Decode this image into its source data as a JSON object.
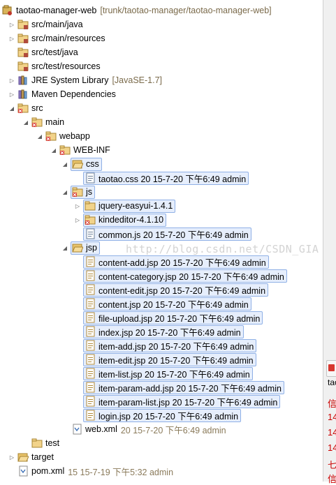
{
  "tree": {
    "project": {
      "name": "taotao-manager-web",
      "path": "[trunk/taotao-manager/taotao-manager-web]"
    },
    "src_main_java": "src/main/java",
    "src_main_resources": "src/main/resources",
    "src_test_java": "src/test/java",
    "src_test_resources": "src/test/resources",
    "jre": {
      "name": "JRE System Library",
      "decoration": "[JavaSE-1.7]"
    },
    "maven": "Maven Dependencies",
    "src": "src",
    "main": "main",
    "webapp": "webapp",
    "webinf": "WEB-INF",
    "css": "css",
    "taotao_css": "taotao.css 20  15-7-20 下午6:49  admin",
    "js": "js",
    "jquery": "jquery-easyui-1.4.1",
    "kindeditor": "kindeditor-4.1.10",
    "common_js": "common.js 20  15-7-20 下午6:49  admin",
    "jsp": "jsp",
    "jsp_files": [
      "content-add.jsp 20  15-7-20 下午6:49  admin",
      "content-category.jsp 20  15-7-20 下午6:49  admin",
      "content-edit.jsp 20  15-7-20 下午6:49  admin",
      "content.jsp 20  15-7-20 下午6:49  admin",
      "file-upload.jsp 20  15-7-20 下午6:49  admin",
      "index.jsp 20  15-7-20 下午6:49  admin",
      "item-add.jsp 20  15-7-20 下午6:49  admin",
      "item-edit.jsp 20  15-7-20 下午6:49  admin",
      "item-list.jsp 20  15-7-20 下午6:49  admin",
      "item-param-add.jsp 20  15-7-20 下午6:49  admin",
      "item-param-list.jsp 20  15-7-20 下午6:49  admin",
      "login.jsp 20  15-7-20 下午6:49  admin"
    ],
    "web_xml": {
      "name": "web.xml",
      "meta": "20  15-7-20 下午6:49  admin"
    },
    "test": "test",
    "target": "target",
    "pom": {
      "name": "pom.xml",
      "meta": "15  15-7-19 下午5:32  admin"
    }
  },
  "watermark": "http://blog.csdn.net/CSDN_GIA",
  "right_panel": {
    "label": "tao",
    "lines": [
      "信",
      "14",
      "14",
      "14",
      "七",
      "信"
    ],
    "text_color": "#cc0000"
  }
}
